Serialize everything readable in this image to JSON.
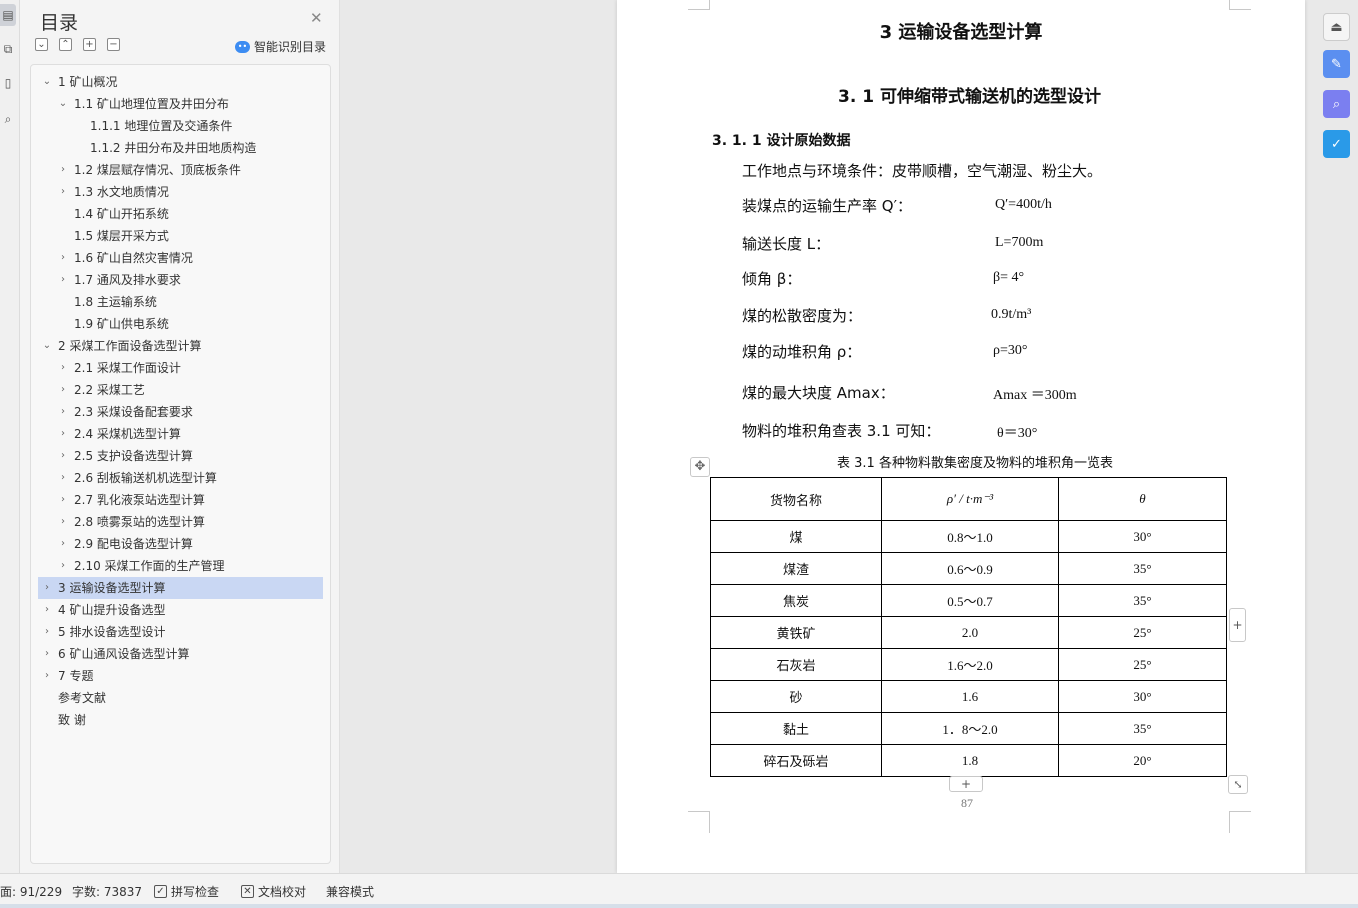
{
  "sidebar_icons": [
    "document-icon",
    "copy-icon",
    "bookmark-icon",
    "search-icon"
  ],
  "toc": {
    "title": "目录",
    "smart_label": "智能识别目录",
    "items": [
      {
        "label": "1 矿山概况",
        "level": 0,
        "state": "expanded"
      },
      {
        "label": "1.1 矿山地理位置及井田分布",
        "level": 1,
        "state": "expanded"
      },
      {
        "label": "1.1.1 地理位置及交通条件",
        "level": 2,
        "state": "none"
      },
      {
        "label": "1.1.2 井田分布及井田地质构造",
        "level": 2,
        "state": "none"
      },
      {
        "label": "1.2 煤层赋存情况、顶底板条件",
        "level": 1,
        "state": "collapsed"
      },
      {
        "label": "1.3 水文地质情况",
        "level": 1,
        "state": "collapsed"
      },
      {
        "label": "1.4 矿山开拓系统",
        "level": 1,
        "state": "none"
      },
      {
        "label": "1.5 煤层开采方式",
        "level": 1,
        "state": "none"
      },
      {
        "label": "1.6 矿山自然灾害情况",
        "level": 1,
        "state": "collapsed"
      },
      {
        "label": "1.7 通风及排水要求",
        "level": 1,
        "state": "collapsed"
      },
      {
        "label": "1.8 主运输系统",
        "level": 1,
        "state": "none"
      },
      {
        "label": "1.9 矿山供电系统",
        "level": 1,
        "state": "none"
      },
      {
        "label": "2 采煤工作面设备选型计算",
        "level": 0,
        "state": "expanded"
      },
      {
        "label": "2.1 采煤工作面设计",
        "level": 1,
        "state": "collapsed"
      },
      {
        "label": "2.2  采煤工艺",
        "level": 1,
        "state": "collapsed"
      },
      {
        "label": "2.3 采煤设备配套要求",
        "level": 1,
        "state": "collapsed"
      },
      {
        "label": "2.4  采煤机选型计算",
        "level": 1,
        "state": "collapsed"
      },
      {
        "label": "2.5 支护设备选型计算",
        "level": 1,
        "state": "collapsed"
      },
      {
        "label": "2.6 刮板输送机机选型计算",
        "level": 1,
        "state": "collapsed"
      },
      {
        "label": "2.7  乳化液泵站选型计算",
        "level": 1,
        "state": "collapsed"
      },
      {
        "label": "2.8 喷雾泵站的选型计算",
        "level": 1,
        "state": "collapsed"
      },
      {
        "label": "2.9  配电设备选型计算",
        "level": 1,
        "state": "collapsed"
      },
      {
        "label": "2.10 采煤工作面的生产管理",
        "level": 1,
        "state": "collapsed"
      },
      {
        "label": "3 运输设备选型计算",
        "level": 0,
        "state": "collapsed",
        "selected": true
      },
      {
        "label": "4 矿山提升设备选型",
        "level": 0,
        "state": "collapsed"
      },
      {
        "label": "5 排水设备选型设计",
        "level": 0,
        "state": "collapsed"
      },
      {
        "label": "6 矿山通风设备选型计算",
        "level": 0,
        "state": "collapsed"
      },
      {
        "label": "7 专题",
        "level": 0,
        "state": "collapsed"
      },
      {
        "label": "参考文献",
        "level": 0,
        "state": "none"
      },
      {
        "label": "致   谢",
        "level": 0,
        "state": "none"
      }
    ]
  },
  "doc": {
    "h1": "3 运输设备选型计算",
    "h2": "3. 1 可伸缩带式输送机的选型设计",
    "h3": "3. 1. 1 设计原始数据",
    "work_env": "工作地点与环境条件：皮带顺槽，空气潮湿、粉尘大。",
    "params": [
      {
        "label": "装煤点的运输生产率 Q′：",
        "value": "Q′=400t/h"
      },
      {
        "label": "输送长度 L：",
        "value": "L=700m"
      },
      {
        "label": "倾角 β：",
        "value": "β= 4°"
      },
      {
        "label": "煤的松散密度为：",
        "value": "0.9t/m³"
      },
      {
        "label": "煤的动堆积角 ρ：",
        "value": "ρ=30°"
      },
      {
        "label": "煤的最大块度 Amax：",
        "value": "Amax ＝300m"
      },
      {
        "label": "物料的堆积角查表 3.1 可知：",
        "value": "θ＝30°"
      }
    ],
    "caption": "表 3.1 各种物料散集密度及物料的堆积角一览表",
    "table": {
      "headers": [
        "货物名称",
        "ρ′ / t·m⁻³",
        "θ"
      ],
      "rows": [
        [
          "煤",
          "0.8～1.0",
          "30°"
        ],
        [
          "煤渣",
          "0.6～0.9",
          "35°"
        ],
        [
          "焦炭",
          "0.5～0.7",
          "35°"
        ],
        [
          "黄铁矿",
          "2.0",
          "25°"
        ],
        [
          "石灰岩",
          "1.6～2.0",
          "25°"
        ],
        [
          "砂",
          "1.6",
          "30°"
        ],
        [
          "黏土",
          "1．8～2.0",
          "35°"
        ],
        [
          "碎石及砾岩",
          "1.8",
          "20°"
        ]
      ]
    },
    "page_number": "87"
  },
  "right_tools": [
    {
      "icon": "collapse-icon",
      "color": "#f5f5f5"
    },
    {
      "icon": "doc-edit-icon",
      "color": "#5b8ff0"
    },
    {
      "icon": "doc-search-icon",
      "color": "#7b7ff0"
    },
    {
      "icon": "doc-check-icon",
      "color": "#2a9ae8"
    }
  ],
  "status": {
    "page": "面: 91/229",
    "words": "字数: 73837",
    "spell": "拼写检查",
    "proof": "文档校对",
    "compat": "兼容模式"
  }
}
